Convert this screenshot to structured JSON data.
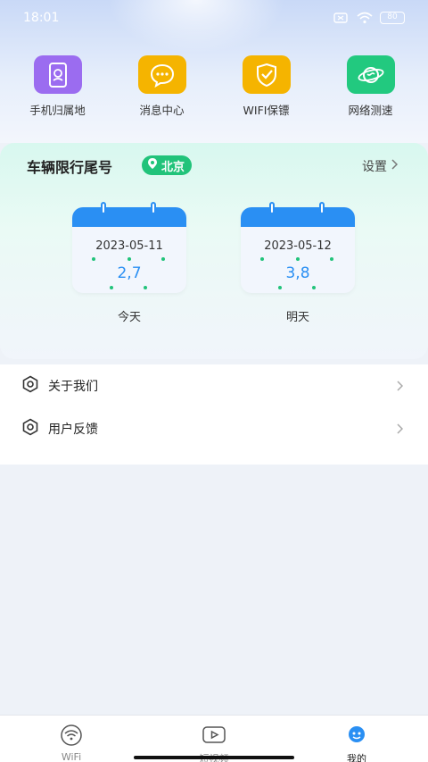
{
  "status_bar": {
    "time": "18:01",
    "battery": "80"
  },
  "quick_actions": [
    {
      "label": "手机归属地",
      "icon": "phone-location-icon",
      "color": "#9b6cf0"
    },
    {
      "label": "消息中心",
      "icon": "message-bubble-icon",
      "color": "#f5b400"
    },
    {
      "label": "WIFI保镖",
      "icon": "shield-check-icon",
      "color": "#f5b400"
    },
    {
      "label": "网络测速",
      "icon": "planet-icon",
      "color": "#22c97f"
    }
  ],
  "limit_card": {
    "title": "车辆限行尾号",
    "city": "北京",
    "settings_label": "设置",
    "days": [
      {
        "date": "2023-05-11",
        "numbers": "2,7",
        "label": "今天"
      },
      {
        "date": "2023-05-12",
        "numbers": "3,8",
        "label": "明天"
      }
    ]
  },
  "menu": [
    {
      "label": "关于我们",
      "icon": "hexagon-icon"
    },
    {
      "label": "用户反馈",
      "icon": "hexagon-icon"
    }
  ],
  "bottom_nav": [
    {
      "label": "WiFi",
      "icon": "wifi-icon",
      "active": false
    },
    {
      "label": "短视频",
      "icon": "video-play-icon",
      "active": false
    },
    {
      "label": "我的",
      "icon": "profile-icon",
      "active": true
    }
  ],
  "colors": {
    "accent_blue": "#2a8ff3",
    "accent_green": "#21c37a"
  }
}
